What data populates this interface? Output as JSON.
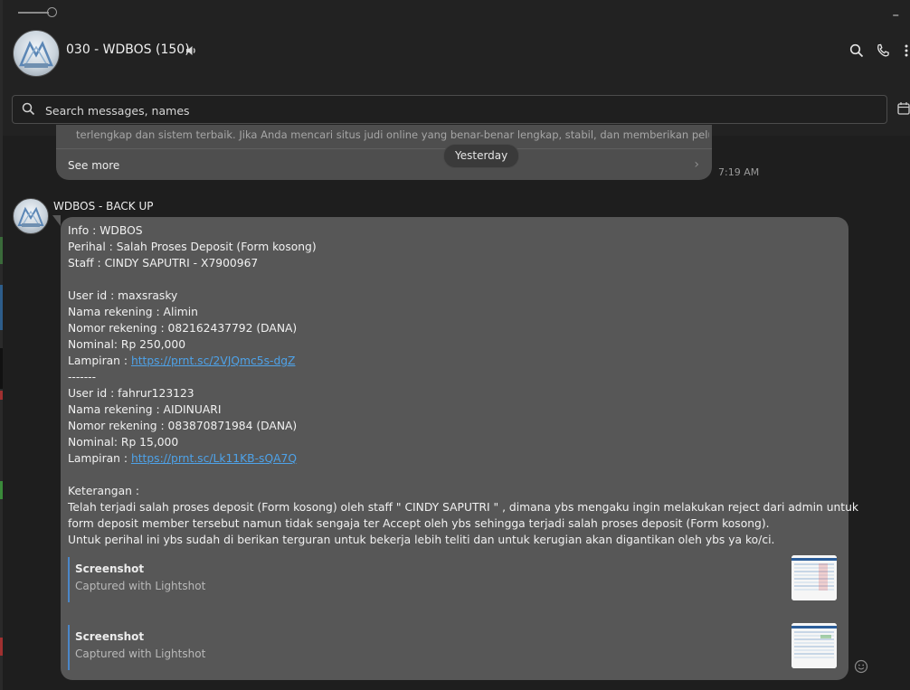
{
  "colors": {
    "background": "#1e1e1e",
    "header": "#222222",
    "bubble": "#575757",
    "link": "#4ea2e8",
    "preview_bar": "#4a86c8"
  },
  "header": {
    "title": "030 - WDBOS",
    "member_count": "(150)",
    "icons": [
      "speaker-icon",
      "search-icon",
      "phone-icon",
      "more-icon"
    ],
    "minimize": "–"
  },
  "search": {
    "placeholder": "Search messages, names",
    "value": ""
  },
  "previous_message": {
    "text": "terlengkap dan sistem terbaik. Jika Anda mencari situs judi online yang benar-benar lengkap, stabil, dan memberikan peluang ke...",
    "see_more": "See more",
    "time": "7:19 AM"
  },
  "date_divider": "Yesterday",
  "message": {
    "sender": "WDBOS - BACK UP",
    "lines": [
      {
        "text": "Info : WDBOS"
      },
      {
        "text": "Perihal : Salah Proses Deposit (Form kosong)"
      },
      {
        "text": "Staff : CINDY SAPUTRI - X7900967"
      },
      {
        "text": ""
      },
      {
        "text": "User id : maxsrasky"
      },
      {
        "text": "Nama rekening : Alimin"
      },
      {
        "text": "Nomor rekening : 082162437792 (DANA)"
      },
      {
        "text": "Nominal: Rp 250,000"
      },
      {
        "text": "Lampiran : ",
        "link": "https://prnt.sc/2VJQmc5s-dgZ"
      },
      {
        "text": "-------"
      },
      {
        "text": "User id : fahrur123123"
      },
      {
        "text": "Nama rekening : AIDINUARI"
      },
      {
        "text": "Nomor rekening : 083870871984 (DANA)"
      },
      {
        "text": "Nominal: Rp 15,000"
      },
      {
        "text": "Lampiran : ",
        "link": "https://prnt.sc/Lk11KB-sQA7Q"
      },
      {
        "text": ""
      },
      {
        "text": "Keterangan :"
      },
      {
        "text": "Telah terjadi salah proses deposit (Form kosong) oleh staff \" CINDY SAPUTRI \" , dimana ybs mengaku ingin melakukan reject dari admin untuk"
      },
      {
        "text": "form deposit member tersebut namun tidak sengaja ter Accept oleh ybs sehingga terjadi salah proses deposit (Form kosong)."
      },
      {
        "text": "Untuk perihal ini ybs sudah di berikan terguran untuk bekerja lebih teliti dan untuk kerugian akan digantikan oleh ybs ya ko/ci."
      }
    ],
    "link_previews": [
      {
        "title": "Screenshot",
        "subtitle": "Captured with Lightshot"
      },
      {
        "title": "Screenshot",
        "subtitle": "Captured with Lightshot"
      }
    ]
  }
}
